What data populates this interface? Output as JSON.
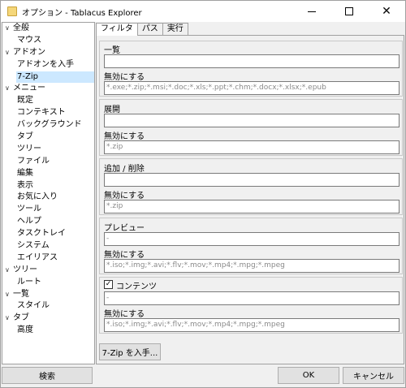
{
  "window": {
    "title": "オプション - Tablacus Explorer",
    "controls": {
      "minimize": "—",
      "maximize": "□",
      "close": "✕"
    }
  },
  "tree": {
    "items": [
      {
        "label": "全般",
        "expanded": true,
        "level": 0
      },
      {
        "label": "マウス",
        "level": 1
      },
      {
        "label": "アドオン",
        "expanded": true,
        "level": 0
      },
      {
        "label": "アドオンを入手",
        "level": 1
      },
      {
        "label": "7-Zip",
        "level": 1,
        "selected": true
      },
      {
        "label": "メニュー",
        "expanded": true,
        "level": 0
      },
      {
        "label": "既定",
        "level": 1
      },
      {
        "label": "コンテキスト",
        "level": 1
      },
      {
        "label": "バックグラウンド",
        "level": 1
      },
      {
        "label": "タブ",
        "level": 1
      },
      {
        "label": "ツリー",
        "level": 1
      },
      {
        "label": "ファイル",
        "level": 1
      },
      {
        "label": "編集",
        "level": 1
      },
      {
        "label": "表示",
        "level": 1
      },
      {
        "label": "お気に入り",
        "level": 1
      },
      {
        "label": "ツール",
        "level": 1
      },
      {
        "label": "ヘルプ",
        "level": 1
      },
      {
        "label": "タスクトレイ",
        "level": 1
      },
      {
        "label": "システム",
        "level": 1
      },
      {
        "label": "エイリアス",
        "level": 1
      },
      {
        "label": "ツリー",
        "expanded": true,
        "level": 0
      },
      {
        "label": "ルート",
        "level": 1
      },
      {
        "label": "一覧",
        "expanded": true,
        "level": 0
      },
      {
        "label": "スタイル",
        "level": 1
      },
      {
        "label": "タブ",
        "expanded": true,
        "level": 0
      },
      {
        "label": "高度",
        "level": 1
      }
    ]
  },
  "tabs": [
    {
      "label": "フィルタ",
      "active": true
    },
    {
      "label": "パス"
    },
    {
      "label": "実行"
    }
  ],
  "groups": [
    {
      "title": "一覧",
      "value": "",
      "disable_label": "無効にする",
      "disable_value": "*.exe;*.zip;*.msi;*.doc;*.xls;*.ppt;*.chm;*.docx;*.xlsx;*.epub"
    },
    {
      "title": "展開",
      "value": "",
      "disable_label": "無効にする",
      "disable_value": "*.zip"
    },
    {
      "title": "追加 / 削除",
      "value": "",
      "disable_label": "無効にする",
      "disable_value": "*.zip"
    },
    {
      "title": "プレビュー",
      "value": "-",
      "disable_label": "無効にする",
      "disable_value": "*.iso;*.img;*.avi;*.flv;*.mov;*.mp4;*.mpg;*.mpeg"
    },
    {
      "title": "コンテンツ",
      "checked": true,
      "value": "-",
      "disable_label": "無効にする",
      "disable_value": "*.iso;*.img;*.avi;*.flv;*.mov;*.mp4;*.mpg;*.mpeg"
    }
  ],
  "buttons": {
    "get_7zip": "7-Zip を入手...",
    "search": "検索",
    "ok": "OK",
    "cancel": "キャンセル"
  },
  "colors": {
    "selection": "#cce8ff",
    "field_border": "#7a7a7a",
    "button_bg": "#e1e1e1"
  },
  "icons": {
    "app": "folder-icon",
    "expand": "chevron-down-icon",
    "check": "checkmark-icon"
  }
}
